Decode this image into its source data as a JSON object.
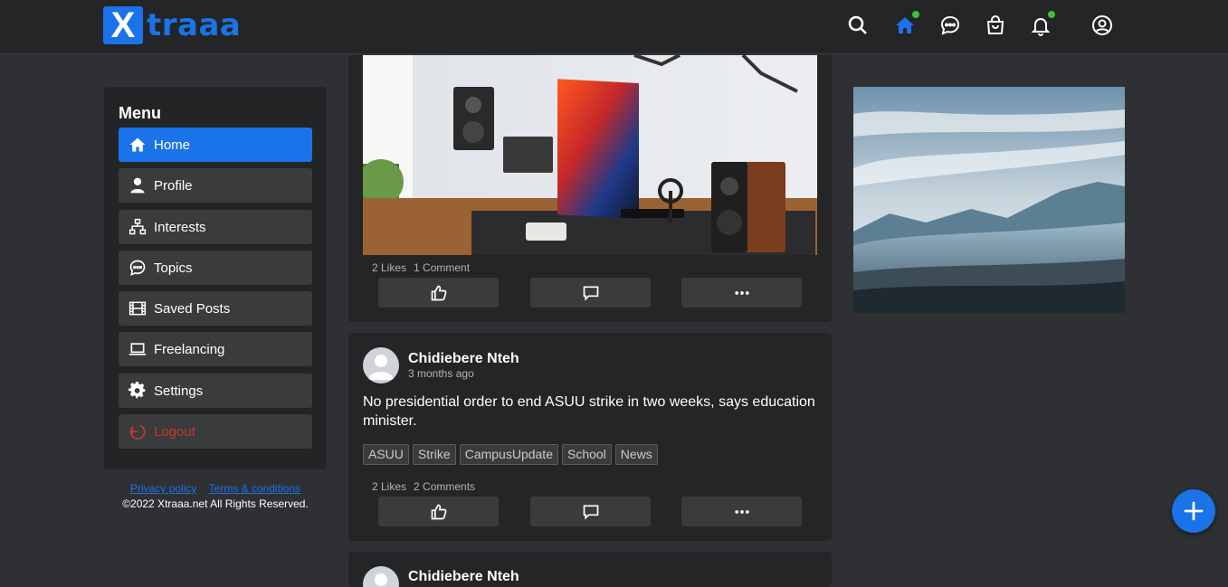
{
  "brand": {
    "logo_letter": "X",
    "logo_text": "traaa"
  },
  "header_icons": [
    "search-icon",
    "home-icon",
    "chat-icon",
    "shopping-bag-icon",
    "bell-icon",
    "user-circle-icon"
  ],
  "menu": {
    "title": "Menu",
    "items": [
      {
        "label": "Home",
        "icon": "home-icon",
        "active": true
      },
      {
        "label": "Profile",
        "icon": "user-icon"
      },
      {
        "label": "Interests",
        "icon": "sitemap-icon"
      },
      {
        "label": "Topics",
        "icon": "comment-icon"
      },
      {
        "label": "Saved Posts",
        "icon": "film-icon"
      },
      {
        "label": "Freelancing",
        "icon": "laptop-icon"
      },
      {
        "label": "Settings",
        "icon": "gear-icon"
      },
      {
        "label": "Logout",
        "icon": "logout-icon"
      }
    ]
  },
  "footer": {
    "privacy": "Privacy policy",
    "terms": "Terms & conditions",
    "copyright": "©2022 Xtraaa.net All Rights Reserved."
  },
  "posts": [
    {
      "likes": "2 Likes",
      "comments": "1 Comment"
    },
    {
      "author": "Chidiebere Nteh",
      "time": "3 months ago",
      "text": "No presidential order to end ASUU strike in two weeks, says education minister.",
      "tags": [
        "ASUU",
        "Strike",
        "CampusUpdate",
        "School",
        "News"
      ],
      "likes": "2 Likes",
      "comments": "2 Comments"
    },
    {
      "author": "Chidiebere Nteh"
    }
  ],
  "colors": {
    "accent": "#1a73e8",
    "online": "#39c23a",
    "logout": "#c0392b",
    "background": "#2f3033",
    "card": "#242526"
  }
}
